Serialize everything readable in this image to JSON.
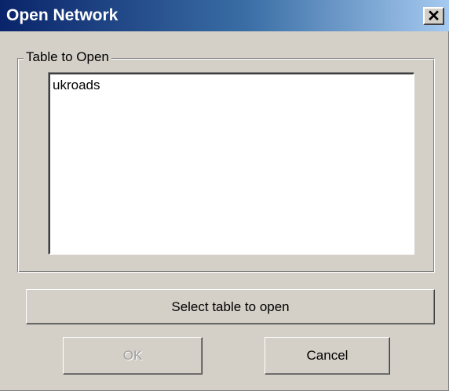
{
  "window": {
    "title": "Open Network",
    "close_label": "✕"
  },
  "group": {
    "label": "Table to Open",
    "items": [
      "ukroads"
    ]
  },
  "buttons": {
    "select_table": "Select table to open",
    "ok": "OK",
    "ok_enabled": false,
    "cancel": "Cancel"
  },
  "colors": {
    "title_gradient_start": "#0a246a",
    "title_gradient_end": "#a6caf0",
    "face": "#d4d0c8",
    "disabled_text": "#a0a0a0"
  }
}
